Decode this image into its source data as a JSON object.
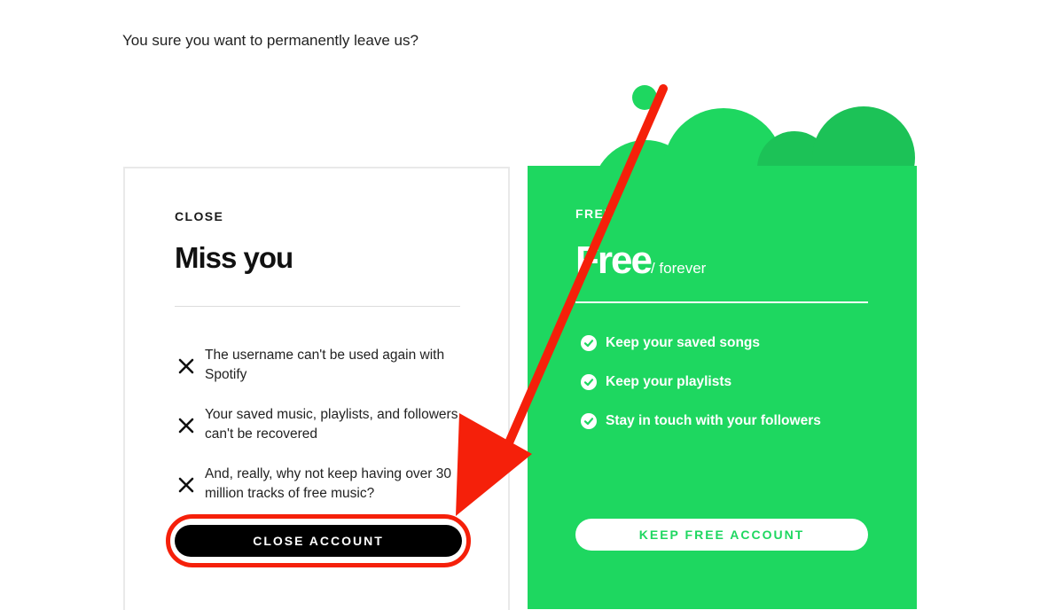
{
  "page": {
    "question": "You sure you want to permanently leave us?"
  },
  "close_card": {
    "eyebrow": "CLOSE",
    "heading": "Miss you",
    "cons": [
      {
        "text": "The username can't be used again with Spotify",
        "icon": "x-icon"
      },
      {
        "text": "Your saved music, playlists, and followers can't be recovered",
        "icon": "x-icon"
      },
      {
        "text": "And, really, why not keep having over 30 million tracks of free music?",
        "icon": "x-icon"
      }
    ],
    "button_label": "CLOSE ACCOUNT"
  },
  "free_card": {
    "eyebrow": "FREE",
    "title": "Free",
    "title_suffix": "/ forever",
    "benefits": [
      {
        "text": "Keep your saved songs",
        "icon": "check-circle-icon"
      },
      {
        "text": "Keep your playlists",
        "icon": "check-circle-icon"
      },
      {
        "text": "Stay in touch with your followers",
        "icon": "check-circle-icon"
      }
    ],
    "button_label": "KEEP FREE ACCOUNT"
  },
  "colors": {
    "spotify_green": "#1ed760",
    "annotation_red": "#f5200a",
    "button_black": "#000000"
  },
  "annotations": {
    "arrow": "red-arrow",
    "highlight": "close-account-highlight-ring"
  }
}
